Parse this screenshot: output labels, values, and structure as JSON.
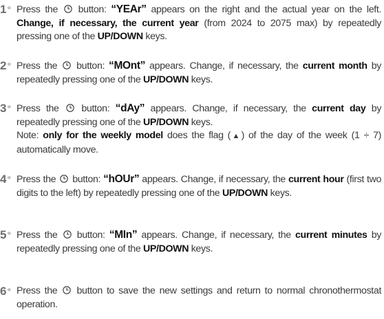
{
  "colors": {
    "text": "#3a3a3a",
    "emphasis": "#111111",
    "step_number": "#6d6d6d"
  },
  "icons": {
    "power": "power-clock-icon",
    "flag": "up-triangle-flag"
  },
  "steps": [
    {
      "num": "1",
      "deg": "°",
      "a": "Press the",
      "b": "button:",
      "word": "“YEAr”",
      "c": "appears on the right and the actual year on the left.",
      "d": "Change, if necessary, the current year",
      "e": "(from 2024 to 2075 max) by repeatedly pressing one of the",
      "f": "UP/DOWN",
      "g": "keys."
    },
    {
      "num": "2",
      "deg": "°",
      "a": "Press the",
      "b": "button:",
      "word": "“MOnt”",
      "c": "appears. Change, if necessary, the",
      "d": "current month",
      "e": "by repeatedly pressing one of the",
      "f": "UP/DOWN",
      "g": "keys."
    },
    {
      "num": "3",
      "deg": "°",
      "a": "Press the",
      "b": "button:",
      "word": "“dAy”",
      "c": "appears. Change, if necessary, the",
      "d": "current day",
      "e": "by repeatedly pressing one of the",
      "f": "UP/DOWN",
      "g": "keys.",
      "note_a": "Note:",
      "note_b": "only for the weekly model",
      "note_c": "does the flag (",
      "note_d": ") of the day of the week (1 ÷ 7) automatically move."
    },
    {
      "num": "4",
      "deg": "°",
      "a": "Press the",
      "b": "button:",
      "word": "“hOUr”",
      "c": "appears. Change, if necessary, the",
      "d": "current hour",
      "e": "(first two digits to the left) by repeatedly pressing one of the",
      "f": "UP/DOWN",
      "g": "keys."
    },
    {
      "num": "5",
      "deg": "°",
      "a": "Press the",
      "b": "button:",
      "word": "“MIn”",
      "c": "appears. Change, if necessary, the",
      "d": "current minutes",
      "e": "by repeatedly pressing one of the",
      "f": "UP/DOWN",
      "g": "keys."
    },
    {
      "num": "6",
      "deg": "°",
      "a": "Press the",
      "b": "button to save the new settings and return to normal chronothermostat operation."
    }
  ]
}
